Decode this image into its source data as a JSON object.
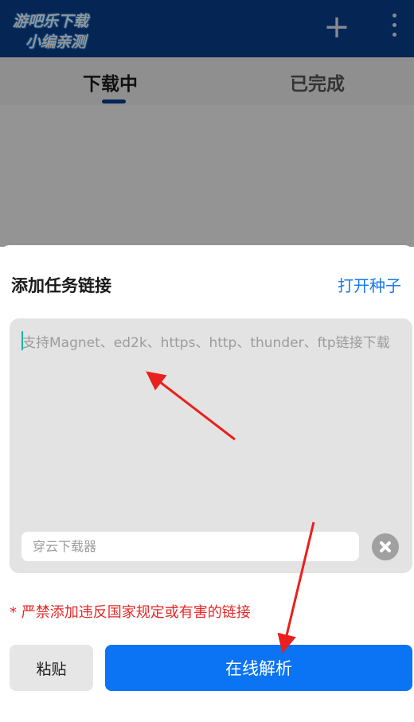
{
  "watermark": {
    "line1": "游吧乐下载",
    "line2": "小编亲测"
  },
  "appbar": {
    "plus_icon": "plus-icon",
    "more_icon": "more-vert-icon"
  },
  "tabs": [
    {
      "label": "下载中",
      "active": true
    },
    {
      "label": "已完成",
      "active": false
    }
  ],
  "sheet": {
    "title": "添加任务链接",
    "open_seed": "打开种子",
    "link_placeholder": "支持Magnet、ed2k、https、http、thunder、ftp链接下载",
    "name_placeholder": "穿云下载器",
    "warning": "* 严禁添加违反国家规定或有害的链接",
    "paste_label": "粘贴",
    "parse_label": "在线解析"
  },
  "colors": {
    "appbar": "#0a4192",
    "accent": "#1478f0",
    "primary_button": "#0b74f4",
    "warning": "#e62727",
    "annotation_arrow": "#e8211d"
  }
}
